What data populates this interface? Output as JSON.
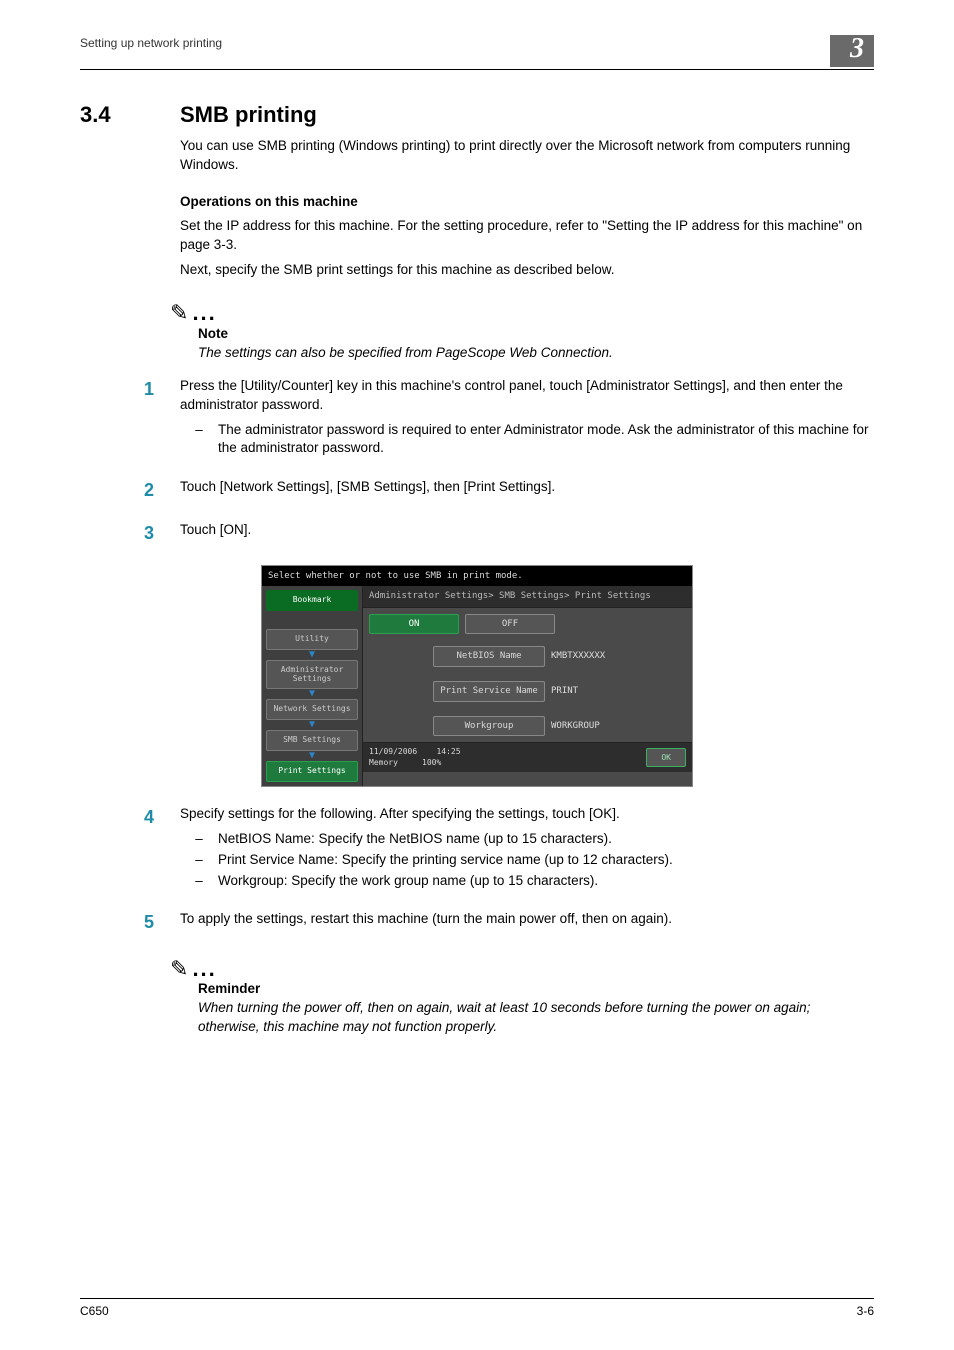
{
  "header": {
    "running_title": "Setting up network printing",
    "chapter_number": "3"
  },
  "section": {
    "number": "3.4",
    "title": "SMB printing",
    "intro": "You can use SMB printing (Windows printing) to print directly over the Microsoft network from computers running Windows.",
    "sub_heading": "Operations on this machine",
    "para1": "Set the IP address for this machine. For the setting procedure, refer to \"Setting the IP address for this machine\" on page 3-3.",
    "para2": "Next, specify the SMB print settings for this machine as described below."
  },
  "note1": {
    "title": "Note",
    "body": "The settings can also be specified from PageScope Web Connection."
  },
  "steps": {
    "s1": {
      "text": "Press the [Utility/Counter] key in this machine's control panel, touch [Administrator Settings], and then enter the administrator password.",
      "bullet1": "The administrator password is required to enter Administrator mode. Ask the administrator of this machine for the administrator password."
    },
    "s2": "Touch [Network Settings], [SMB Settings], then [Print Settings].",
    "s3": "Touch [ON].",
    "s4": {
      "text": "Specify settings for the following. After specifying the settings, touch [OK].",
      "b1": "NetBIOS Name: Specify the NetBIOS name (up to 15 characters).",
      "b2": "Print Service Name: Specify the printing service name (up to 12 characters).",
      "b3": "Workgroup: Specify the work group name (up to 15 characters)."
    },
    "s5": "To apply the settings, restart this machine (turn the main power off, then on again)."
  },
  "note2": {
    "title": "Reminder",
    "body": "When turning the power off, then on again, wait at least 10 seconds before turning the power on again; otherwise, this machine may not function properly."
  },
  "panel": {
    "instruction": "Select whether or not to use SMB in print mode.",
    "breadcrumb": "Administrator Settings> SMB Settings> Print Settings",
    "side": {
      "bookmark": "Bookmark",
      "utility": "Utility",
      "admin": "Administrator Settings",
      "network": "Network Settings",
      "smb": "SMB Settings",
      "print": "Print Settings"
    },
    "on": "ON",
    "off": "OFF",
    "fields": {
      "netbios_label": "NetBIOS Name",
      "netbios_value": "KMBTXXXXXX",
      "service_label": "Print Service Name",
      "service_value": "PRINT",
      "workgroup_label": "Workgroup",
      "workgroup_value": "WORKGROUP"
    },
    "footer": {
      "date": "11/09/2006",
      "time": "14:25",
      "mem_label": "Memory",
      "mem_value": "100%",
      "ok": "OK"
    }
  },
  "footer": {
    "left": "C650",
    "right": "3-6"
  }
}
